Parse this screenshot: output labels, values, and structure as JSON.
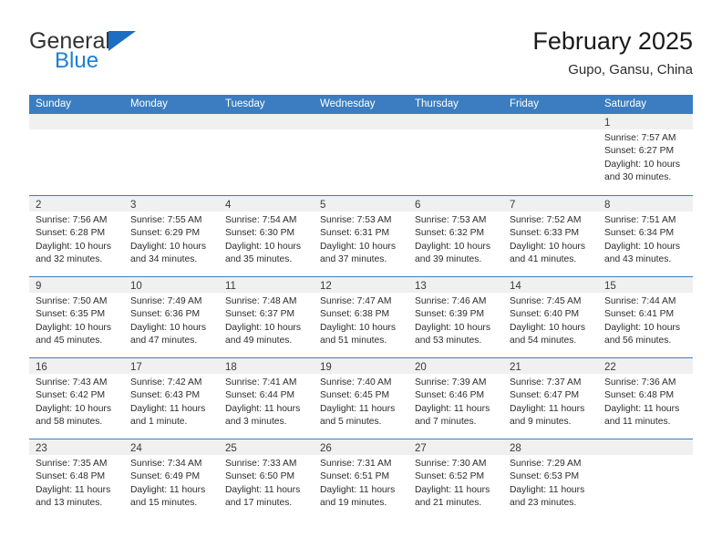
{
  "brand": {
    "name_top": "General",
    "name_bottom": "Blue",
    "accent_color": "#1b7fd4",
    "triangle_color": "#1b6ec2"
  },
  "header": {
    "title": "February 2025",
    "subtitle": "Gupo, Gansu, China"
  },
  "theme": {
    "header_row_bg": "#3b7dc0",
    "day_band_bg": "#f0f0f0",
    "row_border": "#3b7dc0"
  },
  "weekdays": [
    "Sunday",
    "Monday",
    "Tuesday",
    "Wednesday",
    "Thursday",
    "Friday",
    "Saturday"
  ],
  "weeks": [
    [
      {
        "day": "",
        "lines": []
      },
      {
        "day": "",
        "lines": []
      },
      {
        "day": "",
        "lines": []
      },
      {
        "day": "",
        "lines": []
      },
      {
        "day": "",
        "lines": []
      },
      {
        "day": "",
        "lines": []
      },
      {
        "day": "1",
        "lines": [
          "Sunrise: 7:57 AM",
          "Sunset: 6:27 PM",
          "Daylight: 10 hours and 30 minutes."
        ]
      }
    ],
    [
      {
        "day": "2",
        "lines": [
          "Sunrise: 7:56 AM",
          "Sunset: 6:28 PM",
          "Daylight: 10 hours and 32 minutes."
        ]
      },
      {
        "day": "3",
        "lines": [
          "Sunrise: 7:55 AM",
          "Sunset: 6:29 PM",
          "Daylight: 10 hours and 34 minutes."
        ]
      },
      {
        "day": "4",
        "lines": [
          "Sunrise: 7:54 AM",
          "Sunset: 6:30 PM",
          "Daylight: 10 hours and 35 minutes."
        ]
      },
      {
        "day": "5",
        "lines": [
          "Sunrise: 7:53 AM",
          "Sunset: 6:31 PM",
          "Daylight: 10 hours and 37 minutes."
        ]
      },
      {
        "day": "6",
        "lines": [
          "Sunrise: 7:53 AM",
          "Sunset: 6:32 PM",
          "Daylight: 10 hours and 39 minutes."
        ]
      },
      {
        "day": "7",
        "lines": [
          "Sunrise: 7:52 AM",
          "Sunset: 6:33 PM",
          "Daylight: 10 hours and 41 minutes."
        ]
      },
      {
        "day": "8",
        "lines": [
          "Sunrise: 7:51 AM",
          "Sunset: 6:34 PM",
          "Daylight: 10 hours and 43 minutes."
        ]
      }
    ],
    [
      {
        "day": "9",
        "lines": [
          "Sunrise: 7:50 AM",
          "Sunset: 6:35 PM",
          "Daylight: 10 hours and 45 minutes."
        ]
      },
      {
        "day": "10",
        "lines": [
          "Sunrise: 7:49 AM",
          "Sunset: 6:36 PM",
          "Daylight: 10 hours and 47 minutes."
        ]
      },
      {
        "day": "11",
        "lines": [
          "Sunrise: 7:48 AM",
          "Sunset: 6:37 PM",
          "Daylight: 10 hours and 49 minutes."
        ]
      },
      {
        "day": "12",
        "lines": [
          "Sunrise: 7:47 AM",
          "Sunset: 6:38 PM",
          "Daylight: 10 hours and 51 minutes."
        ]
      },
      {
        "day": "13",
        "lines": [
          "Sunrise: 7:46 AM",
          "Sunset: 6:39 PM",
          "Daylight: 10 hours and 53 minutes."
        ]
      },
      {
        "day": "14",
        "lines": [
          "Sunrise: 7:45 AM",
          "Sunset: 6:40 PM",
          "Daylight: 10 hours and 54 minutes."
        ]
      },
      {
        "day": "15",
        "lines": [
          "Sunrise: 7:44 AM",
          "Sunset: 6:41 PM",
          "Daylight: 10 hours and 56 minutes."
        ]
      }
    ],
    [
      {
        "day": "16",
        "lines": [
          "Sunrise: 7:43 AM",
          "Sunset: 6:42 PM",
          "Daylight: 10 hours and 58 minutes."
        ]
      },
      {
        "day": "17",
        "lines": [
          "Sunrise: 7:42 AM",
          "Sunset: 6:43 PM",
          "Daylight: 11 hours and 1 minute."
        ]
      },
      {
        "day": "18",
        "lines": [
          "Sunrise: 7:41 AM",
          "Sunset: 6:44 PM",
          "Daylight: 11 hours and 3 minutes."
        ]
      },
      {
        "day": "19",
        "lines": [
          "Sunrise: 7:40 AM",
          "Sunset: 6:45 PM",
          "Daylight: 11 hours and 5 minutes."
        ]
      },
      {
        "day": "20",
        "lines": [
          "Sunrise: 7:39 AM",
          "Sunset: 6:46 PM",
          "Daylight: 11 hours and 7 minutes."
        ]
      },
      {
        "day": "21",
        "lines": [
          "Sunrise: 7:37 AM",
          "Sunset: 6:47 PM",
          "Daylight: 11 hours and 9 minutes."
        ]
      },
      {
        "day": "22",
        "lines": [
          "Sunrise: 7:36 AM",
          "Sunset: 6:48 PM",
          "Daylight: 11 hours and 11 minutes."
        ]
      }
    ],
    [
      {
        "day": "23",
        "lines": [
          "Sunrise: 7:35 AM",
          "Sunset: 6:48 PM",
          "Daylight: 11 hours and 13 minutes."
        ]
      },
      {
        "day": "24",
        "lines": [
          "Sunrise: 7:34 AM",
          "Sunset: 6:49 PM",
          "Daylight: 11 hours and 15 minutes."
        ]
      },
      {
        "day": "25",
        "lines": [
          "Sunrise: 7:33 AM",
          "Sunset: 6:50 PM",
          "Daylight: 11 hours and 17 minutes."
        ]
      },
      {
        "day": "26",
        "lines": [
          "Sunrise: 7:31 AM",
          "Sunset: 6:51 PM",
          "Daylight: 11 hours and 19 minutes."
        ]
      },
      {
        "day": "27",
        "lines": [
          "Sunrise: 7:30 AM",
          "Sunset: 6:52 PM",
          "Daylight: 11 hours and 21 minutes."
        ]
      },
      {
        "day": "28",
        "lines": [
          "Sunrise: 7:29 AM",
          "Sunset: 6:53 PM",
          "Daylight: 11 hours and 23 minutes."
        ]
      },
      {
        "day": "",
        "lines": []
      }
    ]
  ]
}
